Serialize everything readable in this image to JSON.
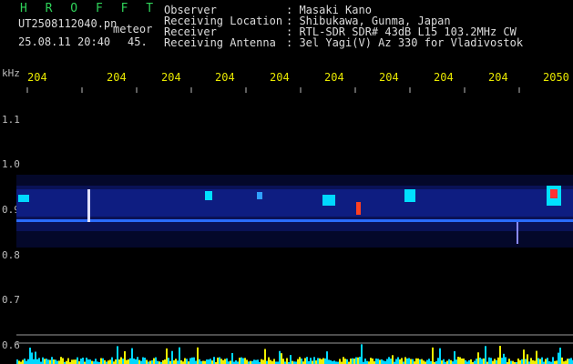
{
  "header": {
    "app_name": "H R O F F T",
    "filename": "UT2508112040.pn",
    "mode": "meteor",
    "datetime": "25.08.11 20:40",
    "count": "45.",
    "fields": [
      {
        "label": "Observer",
        "value": ": Masaki Kano"
      },
      {
        "label": "Receiving Location",
        "value": ": Shibukawa, Gunma, Japan"
      },
      {
        "label": "Receiver",
        "value": ": RTL-SDR SDR# 43dB L15 103.2MHz CW"
      },
      {
        "label": "Receiving Antenna",
        "value": ": 3el Yagi(V) Az 330 for Vladivostok"
      }
    ]
  },
  "time_axis": {
    "labels": [
      "204",
      "204",
      "204",
      "204",
      "204",
      "204",
      "204",
      "204",
      "204",
      "2050"
    ]
  },
  "freq_axis": {
    "unit": "kHz",
    "labels": [
      "1.1",
      "1.0",
      "0.9",
      "0.8",
      "0.7",
      "0.6"
    ]
  },
  "colors": {
    "background": "#000000",
    "title_green": "#2fd35a",
    "tick_yellow": "#e8e800",
    "signal_blue": "#2040ff",
    "signal_cyan": "#00e0ff",
    "histogram_yellow": "#f0f000"
  }
}
